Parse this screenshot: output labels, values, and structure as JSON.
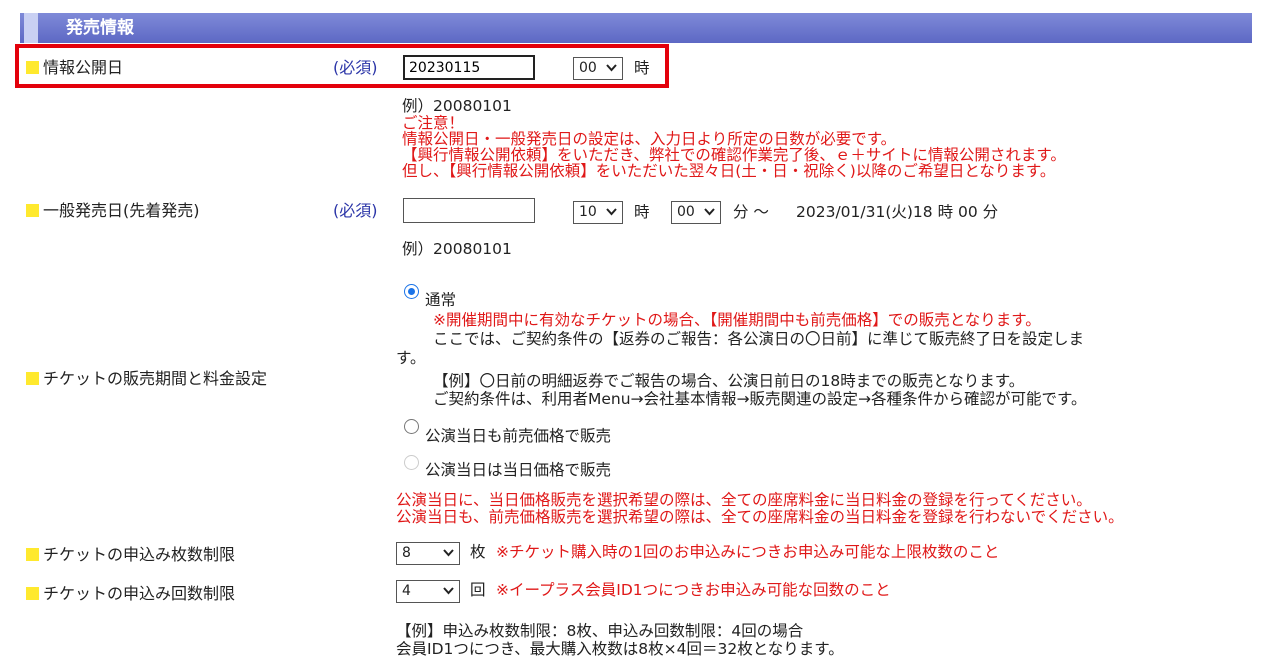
{
  "section": {
    "title": "発売情報"
  },
  "info_date": {
    "label": "情報公開日",
    "required": "(必須)",
    "value": "20230115",
    "hour_value": "00",
    "hour_unit": "時",
    "example": "例）20080101",
    "note_title": "ご注意！",
    "note_lines": [
      "情報公開日・一般発売日の設定は、入力日より所定の日数が必要です。",
      "【興行情報公開依頼】をいただき、弊社での確認作業完了後、ｅ＋サイトに情報公開されます。",
      "但し、【興行情報公開依頼】をいただいた翌々日(土・日・祝除く)以降のご希望日となります。"
    ]
  },
  "general_sale": {
    "label": "一般発売日(先着発売)",
    "required": "(必須)",
    "value": "",
    "hour_value": "10",
    "hour_unit": "時",
    "minute_value": "00",
    "minute_unit": "分 ～",
    "end_text": "2023/01/31(火)18 時 00 分",
    "example": "例）20080101"
  },
  "ticket_period": {
    "label": "チケットの販売期間と料金設定",
    "options": [
      {
        "label": "通常",
        "selected": true,
        "note_red": "※開催期間中に有効なチケットの場合、【開催期間中も前売価格】での販売となります。",
        "note_line1": "ここでは、ご契約条件の【返券のご報告：各公演日の〇日前】に準じて販売終了日を設定しま",
        "note_line1_wrap": "す。",
        "example_line": "【例】〇日前の明細返券でご報告の場合、公演日前日の18時までの販売となります。",
        "contract_line": "ご契約条件は、利用者Menu→会社基本情報→販売関連の設定→各種条件から確認が可能です。"
      },
      {
        "label": "公演当日も前売価格で販売",
        "selected": false
      },
      {
        "label": "公演当日は当日価格で販売",
        "selected": false,
        "disabled": true
      }
    ],
    "warn_lines": [
      "公演当日に、当日価格販売を選択希望の際は、全ての座席料金に当日料金の登録を行ってください。",
      "公演当日も、前売価格販売を選択希望の際は、全ての座席料金の当日料金を登録を行わないでください。"
    ]
  },
  "limit_count": {
    "label": "チケットの申込み枚数制限",
    "value": "8",
    "unit": "枚",
    "note": "※チケット購入時の1回のお申込みにつきお申込み可能な上限枚数のこと"
  },
  "limit_times": {
    "label": "チケットの申込み回数制限",
    "value": "4",
    "unit": "回",
    "note": "※イープラス会員ID1つにつきお申込み可能な回数のこと"
  },
  "bottom_example": {
    "line1": "【例】申込み枚数制限：8枚、申込み回数制限：4回の場合",
    "line2": "会員ID1つにつき、最大購入枚数は8枚×4回＝32枚となります。"
  },
  "colors": {
    "header": "#6a75cf",
    "required": "#2b35a8",
    "warning": "#e01818",
    "highlight": "#e3000b",
    "bullet": "#ffe92e"
  }
}
